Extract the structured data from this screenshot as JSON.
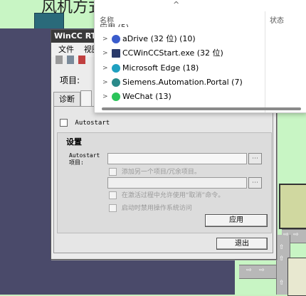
{
  "background": {
    "hmi_title": "风机方式"
  },
  "dialog": {
    "title": "WinCC RT S",
    "menu": [
      "文件",
      "视图"
    ],
    "project_label": "项目:",
    "tabs": {
      "diagnostics": "诊断",
      "second": "A"
    },
    "autostart_checkbox": "Autostart",
    "settings": {
      "title": "设置",
      "autostart_label_line1": "Autostart",
      "autostart_label_line2": "项目:",
      "add_project_checkbox": "添加另一个项目/冗余项目。",
      "allow_cancel_checkbox": "在激活过程中允许使用“取消”命令。",
      "disable_os_access_checkbox": "启动时禁用操作系统访问",
      "apply_button": "应用"
    },
    "exit_button": "退出"
  },
  "popup": {
    "columns": {
      "name": "名称",
      "status": "状态"
    },
    "group_header": "应用 (5)",
    "items": [
      {
        "label": "aDrive (32 位) (10)",
        "icon": "adrive-icon"
      },
      {
        "label": "CCWinCCStart.exe (32 位)",
        "icon": "wincc-start-icon"
      },
      {
        "label": "Microsoft Edge (18)",
        "icon": "edge-icon"
      },
      {
        "label": "Siemens.Automation.Portal (7)",
        "icon": "siemens-portal-icon"
      },
      {
        "label": "WeChat (13)",
        "icon": "wechat-icon"
      }
    ]
  },
  "colors": {
    "hmi_green": "#c8f5c4",
    "hmi_navy": "#4a4a6a",
    "dialog_title_bg": "#3a3a3a"
  }
}
